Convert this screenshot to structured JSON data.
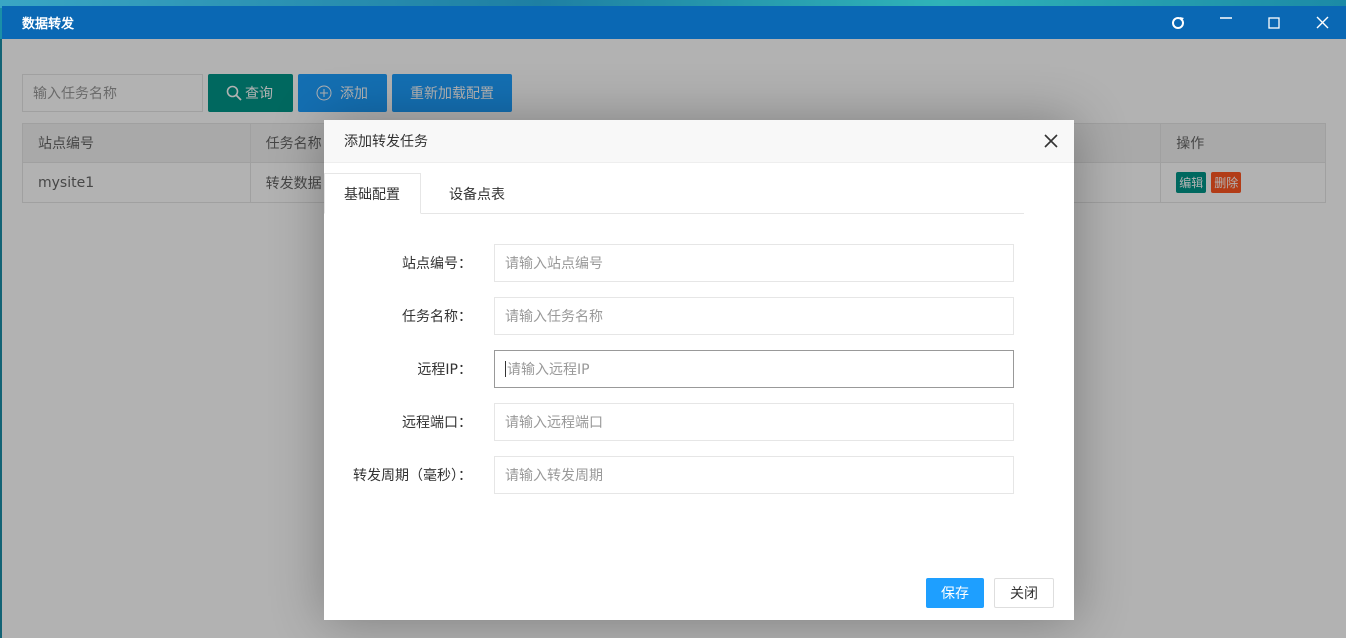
{
  "window": {
    "title": "数据转发",
    "controls": [
      "refresh-icon",
      "minimize-icon",
      "maximize-icon",
      "close-icon"
    ]
  },
  "toolbar": {
    "search_placeholder": "输入任务名称",
    "query_label": "查询",
    "add_label": "添加",
    "reload_label": "重新加载配置"
  },
  "table": {
    "headers": [
      "站点编号",
      "任务名称",
      "操作"
    ],
    "rows": [
      {
        "site": "mysite1",
        "task": "转发数据",
        "edit": "编辑",
        "delete": "删除"
      }
    ]
  },
  "modal": {
    "title": "添加转发任务",
    "tabs": [
      "基础配置",
      "设备点表"
    ],
    "fields": [
      {
        "label": "站点编号：",
        "placeholder": "请输入站点编号"
      },
      {
        "label": "任务名称：",
        "placeholder": "请输入任务名称"
      },
      {
        "label": "远程IP：",
        "placeholder": "请输入远程IP"
      },
      {
        "label": "远程端口：",
        "placeholder": "请输入远程端口"
      },
      {
        "label": "转发周期（毫秒）：",
        "placeholder": "请输入转发周期"
      }
    ],
    "save_label": "保存",
    "close_label": "关闭"
  },
  "colors": {
    "titlebar": "#0a68b4",
    "primary": "#1e9fff",
    "green": "#009688",
    "danger": "#ff5722"
  }
}
